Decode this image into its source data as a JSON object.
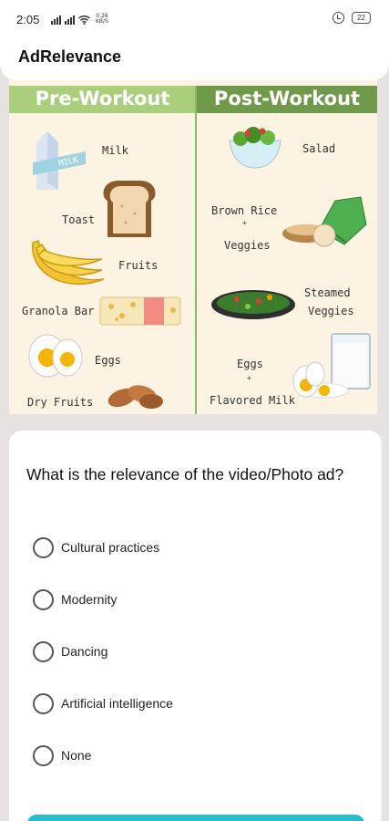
{
  "status_bar": {
    "time": "2:05",
    "net_speed_value": "0.26",
    "net_speed_unit": "KB/S",
    "battery": "22"
  },
  "app": {
    "title": "AdRelevance"
  },
  "ad_image": {
    "left_header": "Pre-Workout",
    "right_header": "Post-Workout",
    "left_items": [
      "Milk",
      "Toast",
      "Fruits",
      "Granola Bar",
      "Eggs",
      "Dry Fruits"
    ],
    "right_items": [
      "Salad",
      "Brown Rice",
      "+",
      "Veggies",
      "Steamed",
      "Veggies",
      "Eggs",
      "+",
      "Flavored Milk"
    ],
    "milk_carton_text": "MILK"
  },
  "survey": {
    "question": "What is the relevance of the video/Photo ad?",
    "options": [
      "Cultural practices",
      "Modernity",
      "Dancing",
      "Artificial intelligence",
      "None"
    ]
  }
}
